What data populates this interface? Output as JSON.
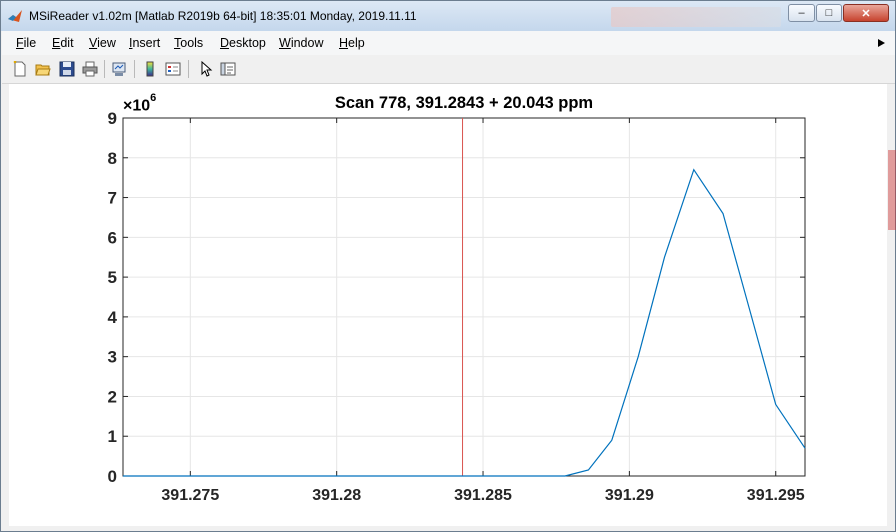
{
  "window": {
    "title": "MSiReader  v1.02m  [Matlab R2019b 64-bit]  18:35:01 Monday, 2019.11.11",
    "controls": {
      "minimize": "–",
      "maximize": "□",
      "close": "✕"
    }
  },
  "menu": {
    "items": [
      {
        "underline": "F",
        "rest": "ile"
      },
      {
        "underline": "E",
        "rest": "dit"
      },
      {
        "underline": "V",
        "rest": "iew"
      },
      {
        "underline": "I",
        "rest": "nsert"
      },
      {
        "underline": "T",
        "rest": "ools"
      },
      {
        "underline": "D",
        "rest": "esktop"
      },
      {
        "underline": "W",
        "rest": "indow"
      },
      {
        "underline": "H",
        "rest": "elp"
      }
    ]
  },
  "toolbar": {
    "icons": [
      "new-figure-icon",
      "open-file-icon",
      "save-icon",
      "print-icon",
      "link-plot-icon",
      "insert-colorbar-icon",
      "insert-legend-icon",
      "edit-plot-arrow-icon",
      "property-inspector-icon"
    ]
  },
  "colors": {
    "line": "#0072bd",
    "cursor": "#d9534f",
    "grid": "#e6e6e6",
    "axis": "#262626"
  },
  "chart_data": {
    "type": "line",
    "title": "Scan 778, 391.2843 + 20.043 ppm",
    "exponent_label": "×10",
    "exponent_power": "6",
    "xlim": [
      391.2727,
      391.296
    ],
    "ylim": [
      0,
      9
    ],
    "xticks": [
      391.275,
      391.28,
      391.285,
      391.29,
      391.295
    ],
    "xtick_labels": [
      "391.275",
      "391.28",
      "391.285",
      "391.29",
      "391.295"
    ],
    "yticks": [
      0,
      1,
      2,
      3,
      4,
      5,
      6,
      7,
      8,
      9
    ],
    "ytick_labels": [
      "0",
      "1",
      "2",
      "3",
      "4",
      "5",
      "6",
      "7",
      "8",
      "9"
    ],
    "grid": true,
    "cursor_x": 391.2843,
    "series": [
      {
        "x": [
          391.2727,
          391.2878,
          391.2886,
          391.2894,
          391.2903,
          391.2912,
          391.2922,
          391.2932,
          391.2941,
          391.295,
          391.296
        ],
        "y": [
          0,
          0,
          0.15,
          0.9,
          3.0,
          5.5,
          7.7,
          6.6,
          4.2,
          1.8,
          0.7
        ]
      }
    ]
  }
}
